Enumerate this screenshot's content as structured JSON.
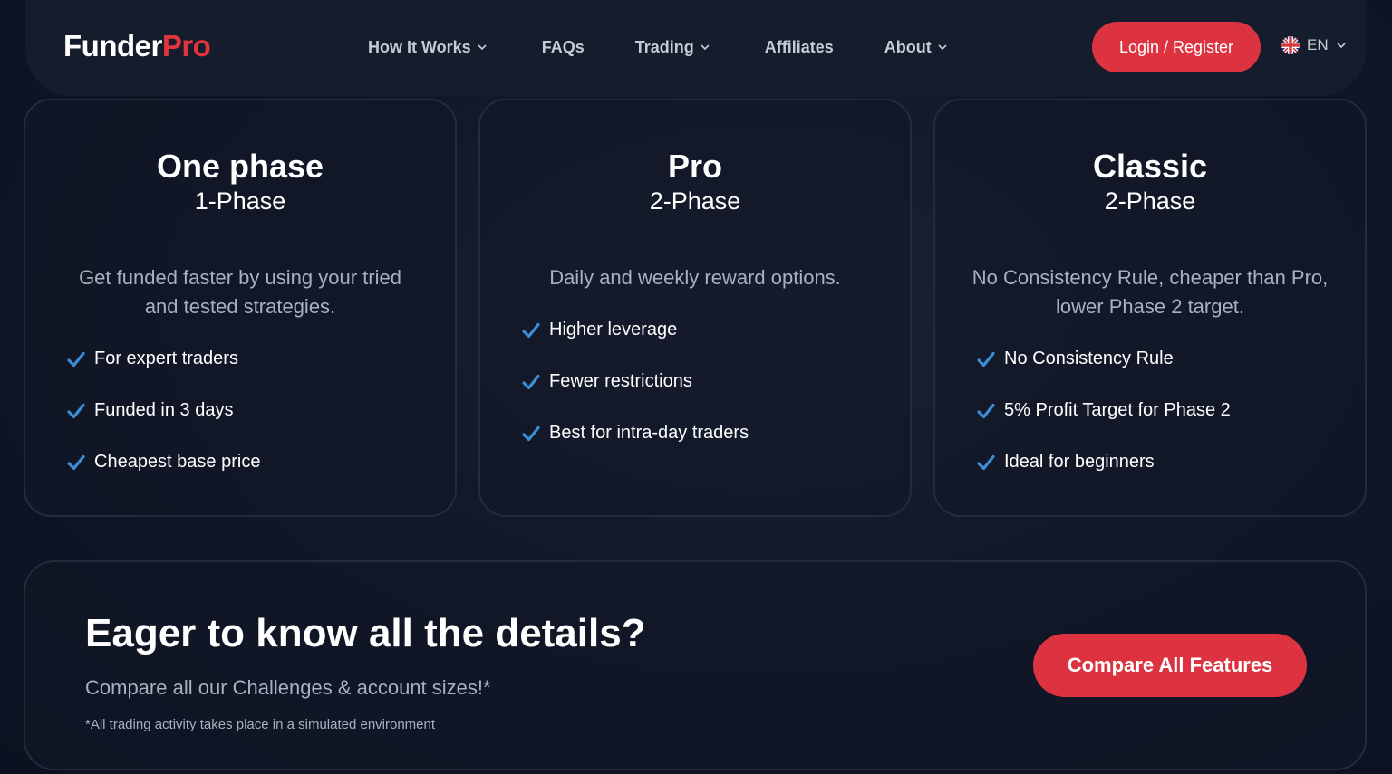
{
  "brand": {
    "name_part1": "Funder",
    "name_part2": "Pro",
    "accent_color": "#dd3340"
  },
  "nav": {
    "links": [
      {
        "label": "How It Works",
        "has_dropdown": true
      },
      {
        "label": "FAQs",
        "has_dropdown": false
      },
      {
        "label": "Trading",
        "has_dropdown": true
      },
      {
        "label": "Affiliates",
        "has_dropdown": false
      },
      {
        "label": "About",
        "has_dropdown": true
      }
    ],
    "login_label": "Login / Register",
    "language": {
      "code": "EN",
      "flag_icon": "uk-flag-icon"
    }
  },
  "cards": [
    {
      "title": "One phase",
      "subtitle": "1-Phase",
      "description": "Get funded faster by using your tried and tested strategies.",
      "features": [
        "For expert traders",
        "Funded in 3 days",
        "Cheapest base price"
      ]
    },
    {
      "title": "Pro",
      "subtitle": "2-Phase",
      "description": "Daily and weekly reward options.",
      "features": [
        "Higher leverage",
        "Fewer restrictions",
        "Best for intra-day traders"
      ]
    },
    {
      "title": "Classic",
      "subtitle": "2-Phase",
      "description": "No Consistency Rule, cheaper than Pro, lower Phase 2 target.",
      "features": [
        "No Consistency Rule",
        "5% Profit Target for Phase 2",
        "Ideal for beginners"
      ]
    }
  ],
  "cta": {
    "title": "Eager to know all the details?",
    "subtitle": "Compare all our Challenges & account sizes!*",
    "note": "*All trading activity takes place in a simulated environment",
    "button_label": "Compare All Features"
  },
  "colors": {
    "check": "#3b8fd6",
    "background": "#0e1424"
  }
}
